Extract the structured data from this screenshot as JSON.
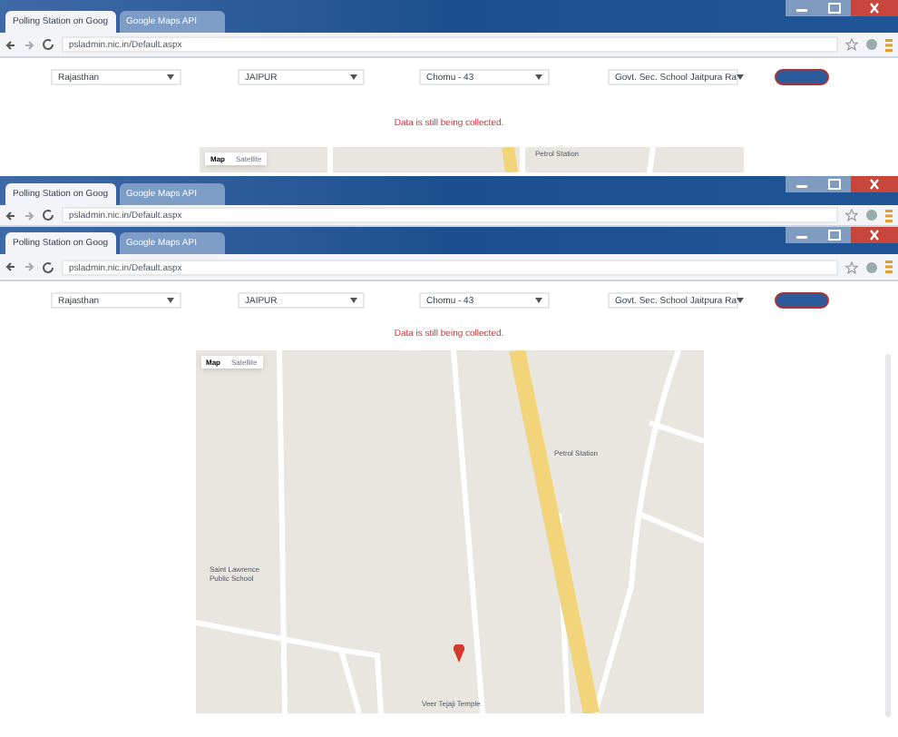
{
  "windows": [
    {
      "tabs": [
        {
          "label": "Polling Station on Goog",
          "selected": true
        },
        {
          "label": "Google Maps API",
          "selected": false
        }
      ],
      "url": "psladmin.nic.in/Default.aspx",
      "page": {
        "selects": [
          "Rajasthan",
          "JAIPUR",
          "Chomu - 43",
          "Govt. Sec. School Jaitpura Ra"
        ],
        "message": "Data is still being collected.",
        "map": {
          "types": [
            {
              "label": "Map",
              "selected": true
            },
            {
              "label": "Satellite",
              "selected": false
            }
          ],
          "places": [
            "Petrol Station"
          ]
        }
      }
    },
    {
      "tabs": [
        {
          "label": "Polling Station on Goog",
          "selected": true
        },
        {
          "label": "Google Maps API",
          "selected": false
        }
      ],
      "url": "psladmin.nic.in/Default.aspx"
    },
    {
      "tabs": [
        {
          "label": "Polling Station on Goog",
          "selected": true
        },
        {
          "label": "Google Maps API",
          "selected": false
        }
      ],
      "url": "psladmin.nic.in/Default.aspx",
      "page": {
        "selects": [
          "Rajasthan",
          "JAIPUR",
          "Chomu - 43",
          "Govt. Sec. School Jaitpura Ra"
        ],
        "message": "Data is still being collected.",
        "map": {
          "types": [
            {
              "label": "Map",
              "selected": true
            },
            {
              "label": "Satellite",
              "selected": false
            }
          ],
          "places": [
            "Petrol Station",
            "Saint Lawrence Public School",
            "Veer Tejaji Temple"
          ]
        }
      }
    }
  ]
}
